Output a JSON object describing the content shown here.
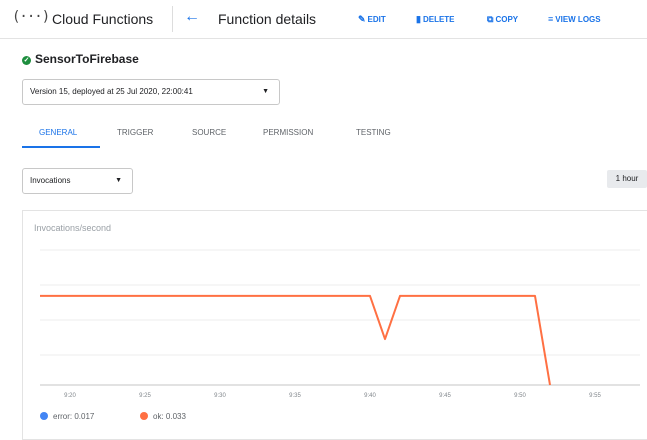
{
  "header": {
    "product_icon": "(···)",
    "product_name": "Cloud Functions",
    "back_icon": "←",
    "title": "Function details",
    "actions": [
      {
        "icon": "✎",
        "label": "EDIT"
      },
      {
        "icon": "▮",
        "label": "DELETE"
      },
      {
        "icon": "⧉",
        "label": "COPY"
      },
      {
        "icon": "≡",
        "label": "VIEW LOGS"
      }
    ]
  },
  "function": {
    "status_icon": "✓",
    "name": "SensorToFirebase",
    "version_label": "Version 15, deployed at 25 Jul 2020, 22:00:41"
  },
  "tabs": [
    "GENERAL",
    "TRIGGER",
    "SOURCE",
    "PERMISSION",
    "TESTING"
  ],
  "active_tab": "GENERAL",
  "metric_select": {
    "value": "Invocations"
  },
  "time_range": "1 hour",
  "colors": {
    "accent": "#1a73e8",
    "error": "#4285f4",
    "ok": "#ff7043",
    "success": "#1e8e3e"
  },
  "chart_data": {
    "type": "line",
    "title": "Invocations/second",
    "x_ticks": [
      "9:20",
      "9:25",
      "9:30",
      "9:35",
      "9:40",
      "9:45",
      "9:50",
      "9:55"
    ],
    "series": [
      {
        "name": "ok",
        "color": "#ff7043",
        "points": [
          [
            "9:18",
            0.033
          ],
          [
            "9:40",
            0.033
          ],
          [
            "9:41",
            0.017
          ],
          [
            "9:42",
            0.033
          ],
          [
            "9:51",
            0.033
          ],
          [
            "9:52",
            0.0
          ]
        ]
      }
    ],
    "ylim": [
      0,
      0.05
    ],
    "grid": true,
    "legend": [
      {
        "name": "error",
        "value": "0.017",
        "color": "#4285f4"
      },
      {
        "name": "ok",
        "value": "0.033",
        "color": "#ff7043"
      }
    ]
  }
}
